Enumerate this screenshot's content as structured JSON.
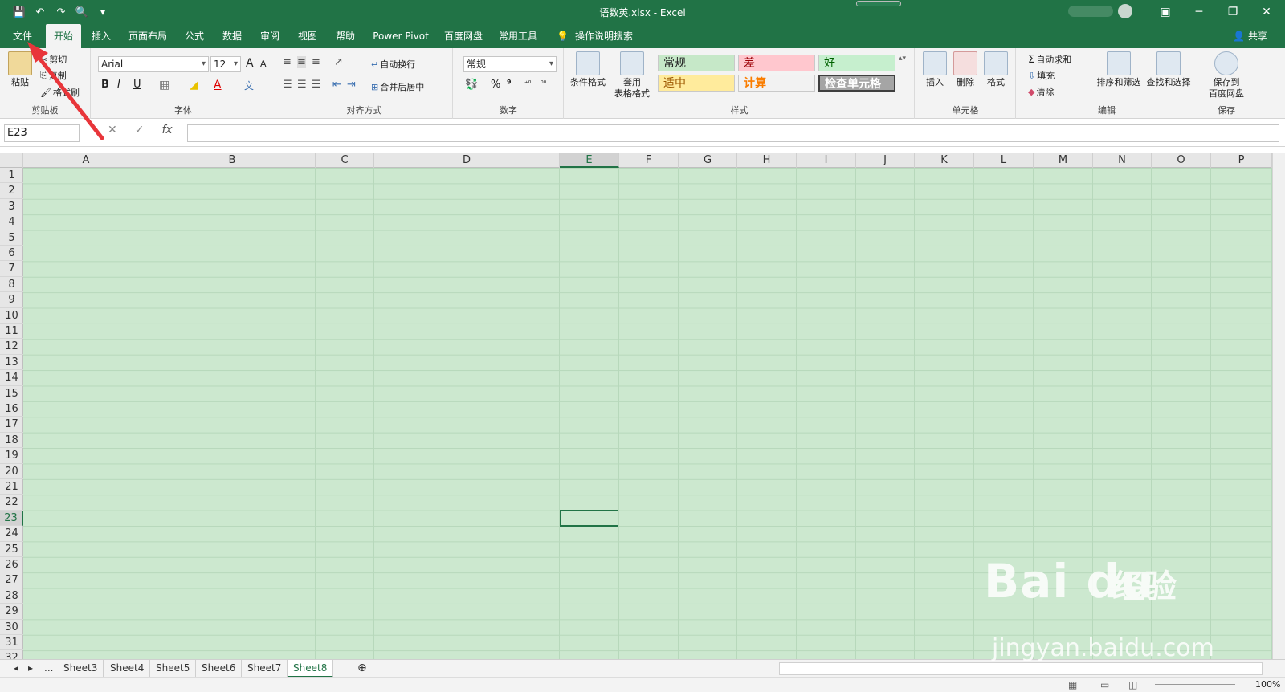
{
  "window": {
    "title": "语数英.xlsx  -  Excel",
    "min": "─",
    "restore": "❐",
    "close": "✕",
    "ribbon_display": "▣"
  },
  "qat": {
    "save_icon": "💾",
    "undo_icon": "↶",
    "redo_icon": "↷",
    "preview_icon": "🔍",
    "more_icon": "▾"
  },
  "tabs": [
    "文件",
    "开始",
    "插入",
    "页面布局",
    "公式",
    "数据",
    "审阅",
    "视图",
    "帮助",
    "Power Pivot",
    "百度网盘",
    "常用工具"
  ],
  "tell_me": {
    "icon": "💡",
    "label": "操作说明搜索"
  },
  "share": {
    "icon": "👤",
    "label": "共享"
  },
  "clipboard": {
    "paste": "粘贴",
    "cut": "剪切",
    "copy": "复制",
    "format_painter": "格式刷",
    "group": "剪贴板"
  },
  "font": {
    "name": "Arial",
    "size": "12",
    "bold": "B",
    "italic": "I",
    "underline": "U",
    "grow": "A",
    "shrink": "A",
    "group": "字体"
  },
  "alignment": {
    "wrap": "自动换行",
    "merge": "合并后居中",
    "group": "对齐方式"
  },
  "number": {
    "format": "常规",
    "percent": "%",
    "comma": "⁹",
    "group": "数字"
  },
  "styles": {
    "conditional": "条件格式",
    "table_line1": "套用",
    "table_line2": "表格格式",
    "normal": "常规",
    "bad": "差",
    "good": "好",
    "neutral": "适中",
    "calc": "计算",
    "check": "检查单元格",
    "group": "样式"
  },
  "cells": {
    "insert": "插入",
    "delete": "删除",
    "format": "格式",
    "group": "单元格"
  },
  "editing": {
    "autosum": "自动求和",
    "fill": "填充",
    "clear": "清除",
    "sort": "排序和筛选",
    "find": "查找和选择",
    "group": "编辑"
  },
  "save_group": {
    "line1": "保存到",
    "line2": "百度网盘",
    "group": "保存"
  },
  "formula_bar": {
    "name_box": "E23",
    "cancel": "✕",
    "enter": "✓",
    "fx": "fx"
  },
  "columns": [
    "A",
    "B",
    "C",
    "D",
    "E",
    "F",
    "G",
    "H",
    "I",
    "J",
    "K",
    "L",
    "M",
    "N",
    "O",
    "P"
  ],
  "rows": [
    "1",
    "2",
    "3",
    "4",
    "5",
    "6",
    "7",
    "8",
    "9",
    "10",
    "11",
    "12",
    "13",
    "14",
    "15",
    "16",
    "17",
    "18",
    "19",
    "20",
    "21",
    "22",
    "23",
    "24",
    "25",
    "26",
    "27",
    "28",
    "29",
    "30",
    "31",
    "32"
  ],
  "selected": {
    "col": "E",
    "row": "23"
  },
  "sheets": {
    "ellipsis": "...",
    "names": [
      "Sheet3",
      "Sheet4",
      "Sheet5",
      "Sheet6",
      "Sheet7",
      "Sheet8"
    ],
    "active": "Sheet8",
    "add": "⊕"
  },
  "status": {
    "zoom": "100%"
  },
  "watermark": {
    "brand": "Bai  du",
    "text": "经验",
    "url": "jingyan.baidu.com"
  }
}
